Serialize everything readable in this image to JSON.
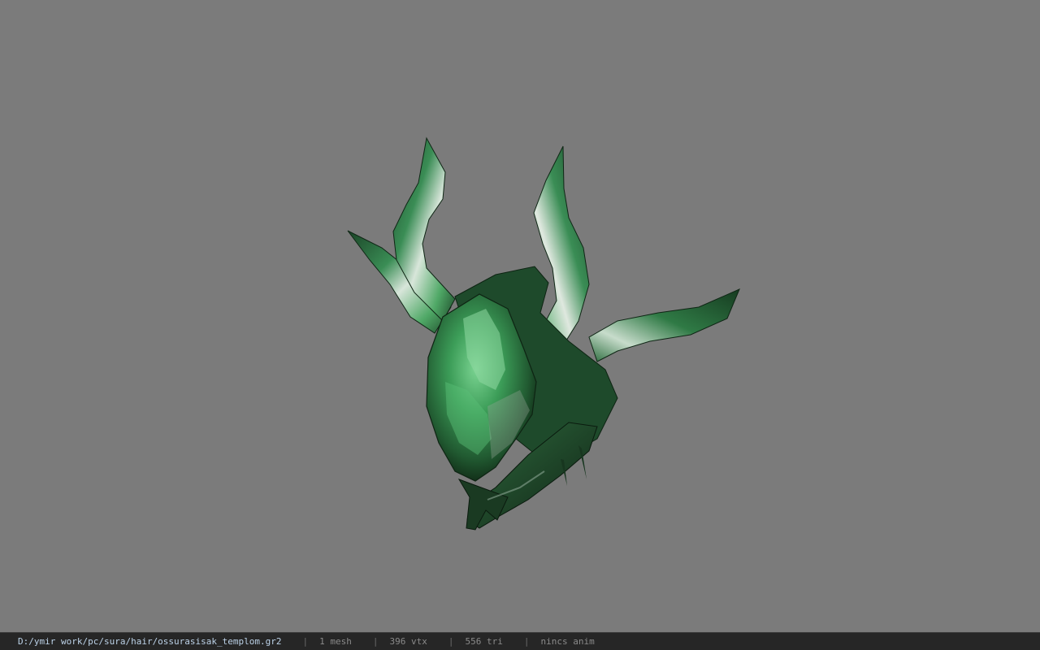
{
  "viewer": {
    "background_color": "#7b7b7b",
    "model_name": "ossurasisak_templom",
    "model_colors": {
      "dark_green": "#1d4a2a",
      "mid_green": "#2f7a45",
      "bright_green": "#4fbf6c",
      "highlight": "#cfe3d4",
      "shadow": "#122a18"
    }
  },
  "status": {
    "path": "D:/ymir work/pc/sura/hair/ossurasisak_templom.gr2",
    "separator": "|",
    "mesh": "1 mesh",
    "vertices": "396 vtx",
    "triangles": "556 tri",
    "animation": "nincs anim"
  }
}
